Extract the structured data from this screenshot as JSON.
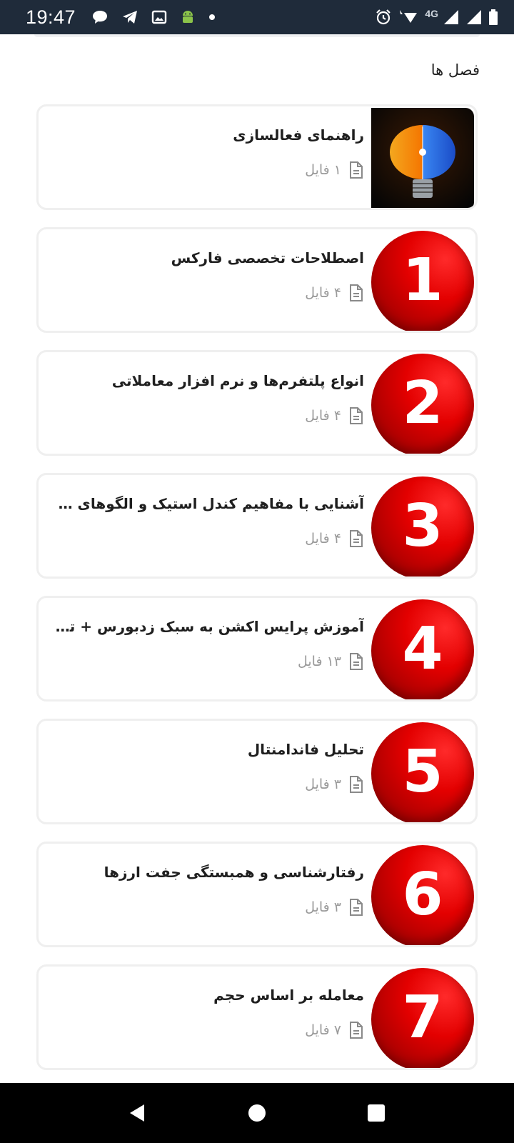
{
  "status_bar": {
    "time": "19:47",
    "network": "4G",
    "left_icons": [
      "chat-bubble-icon",
      "telegram-icon",
      "gallery-icon",
      "android-icon",
      "dot-icon"
    ],
    "right_icons": [
      "alarm-icon",
      "wifi-icon",
      "signal-icon",
      "signal-icon",
      "battery-icon"
    ]
  },
  "section": {
    "title": "فصل ها"
  },
  "chapters": [
    {
      "title": "راهنمای فعالسازی",
      "files": "۱ فایل",
      "thumb": "image",
      "number": ""
    },
    {
      "title": "اصطلاحات تخصصی فارکس",
      "files": "۴ فایل",
      "thumb": "number",
      "number": "1"
    },
    {
      "title": "انواع پلتفرم‌ها و نرم افزار معاملاتی",
      "files": "۴ فایل",
      "thumb": "number",
      "number": "2"
    },
    {
      "title": "آشنایی با مفاهیم کندل استیک و الگوهای کندلی",
      "files": "۴ فایل",
      "thumb": "number",
      "number": "3"
    },
    {
      "title": "آموزش پرایس اکشن به سبک زدبورس + ترید لا...",
      "files": "۱۳ فایل",
      "thumb": "number",
      "number": "4"
    },
    {
      "title": "تحلیل فاندامنتال",
      "files": "۳ فایل",
      "thumb": "number",
      "number": "5"
    },
    {
      "title": "رفتارشناسی و همبستگی جفت ارزها",
      "files": "۳ فایل",
      "thumb": "number",
      "number": "6"
    },
    {
      "title": "معامله بر اساس حجم",
      "files": "۷ فایل",
      "thumb": "number",
      "number": "7"
    }
  ],
  "nav_bar": {
    "buttons": [
      "back-icon",
      "home-icon",
      "recents-icon"
    ]
  },
  "colors": {
    "status_bar_bg": "#1f2b3a",
    "accent_red": "#e30000",
    "nav_bar_bg": "#000000"
  }
}
